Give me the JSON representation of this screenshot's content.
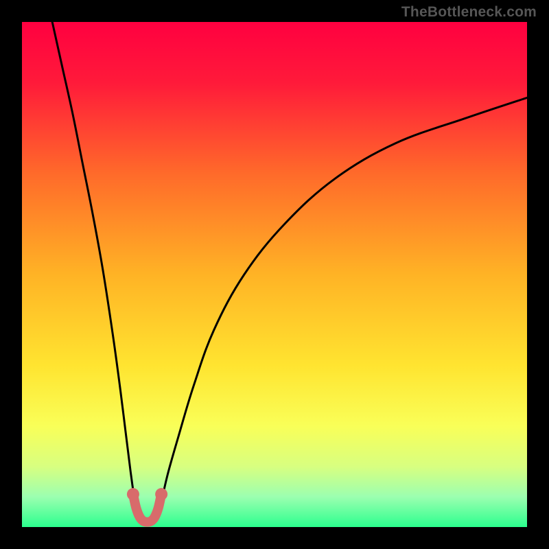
{
  "watermark": "TheBottleneck.com",
  "chart_data": {
    "type": "line",
    "title": "",
    "xlabel": "",
    "ylabel": "",
    "xlim": [
      0,
      100
    ],
    "ylim": [
      0,
      100
    ],
    "gradient_stops": [
      {
        "pos": 0.0,
        "color": "#ff0040"
      },
      {
        "pos": 0.12,
        "color": "#ff1a3a"
      },
      {
        "pos": 0.3,
        "color": "#ff6a2a"
      },
      {
        "pos": 0.5,
        "color": "#ffb325"
      },
      {
        "pos": 0.68,
        "color": "#ffe430"
      },
      {
        "pos": 0.8,
        "color": "#f9ff58"
      },
      {
        "pos": 0.88,
        "color": "#d8ff80"
      },
      {
        "pos": 0.94,
        "color": "#9cffb0"
      },
      {
        "pos": 1.0,
        "color": "#2bff8e"
      }
    ],
    "series": [
      {
        "name": "left-arm",
        "x": [
          6,
          8,
          10,
          12,
          14,
          16,
          18,
          19.5,
          20.5,
          21.5,
          22.2,
          22.7,
          23.1
        ],
        "y": [
          100,
          91,
          82,
          72,
          62,
          51,
          38,
          27,
          19,
          11,
          6,
          3,
          1.5
        ]
      },
      {
        "name": "right-arm",
        "x": [
          26.5,
          27.0,
          27.8,
          29,
          31,
          34,
          38,
          44,
          52,
          62,
          74,
          88,
          100
        ],
        "y": [
          1.5,
          3,
          6,
          11,
          18,
          28,
          39,
          50,
          60,
          69,
          76,
          81,
          85
        ]
      },
      {
        "name": "valley-highlight",
        "points": [
          {
            "x": 22.0,
            "y": 6.5
          },
          {
            "x": 22.6,
            "y": 3.8
          },
          {
            "x": 23.3,
            "y": 2.0
          },
          {
            "x": 24.0,
            "y": 1.2
          },
          {
            "x": 24.8,
            "y": 1.0
          },
          {
            "x": 25.6,
            "y": 1.2
          },
          {
            "x": 26.3,
            "y": 2.0
          },
          {
            "x": 27.0,
            "y": 3.8
          },
          {
            "x": 27.6,
            "y": 6.5
          }
        ]
      }
    ],
    "valley_x_range": [
      22.0,
      27.6
    ],
    "valley_min_y": 1.0,
    "highlight_color": "#d86b6b",
    "curve_color": "#000000"
  }
}
